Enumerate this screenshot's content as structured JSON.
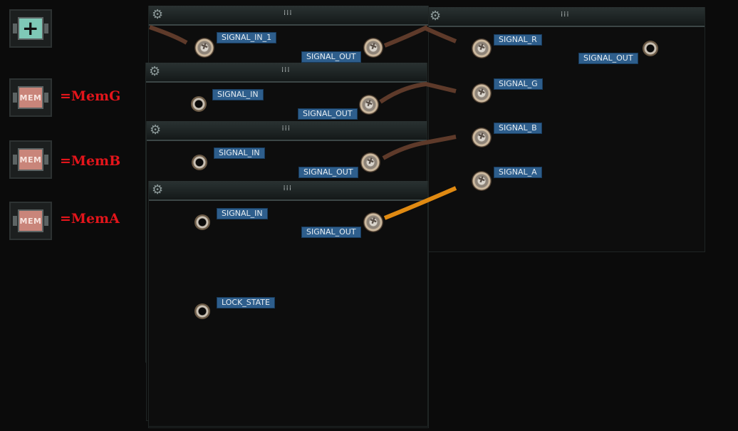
{
  "components": [
    {
      "name": "plus",
      "glyph": "+"
    },
    {
      "name": "memg",
      "glyph": "MEM",
      "alias": "=MemG"
    },
    {
      "name": "memb",
      "glyph": "MEM",
      "alias": "=MemB"
    },
    {
      "name": "mema",
      "glyph": "MEM",
      "alias": "=MemA"
    }
  ],
  "panels": {
    "combiner": {
      "in1": "SIGNAL_IN_1",
      "out": "SIGNAL_OUT"
    },
    "memg": {
      "in": "SIGNAL_IN",
      "out": "SIGNAL_OUT"
    },
    "memb": {
      "in": "SIGNAL_IN",
      "out": "SIGNAL_OUT"
    },
    "mema": {
      "in": "SIGNAL_IN",
      "out": "SIGNAL_OUT",
      "lock": "LOCK_STATE"
    },
    "rgb": {
      "r": "SIGNAL_R",
      "g": "SIGNAL_G",
      "b": "SIGNAL_B",
      "a": "SIGNAL_A",
      "out": "SIGNAL_OUT"
    }
  },
  "colors": {
    "wire_brown": "#5e3a2a",
    "wire_orange": "#e08a12",
    "alias_red": "#e3151b",
    "label_blue": "#2e5e8c"
  },
  "icons": {
    "settings": "gear-icon",
    "drag": "grip-icon"
  }
}
